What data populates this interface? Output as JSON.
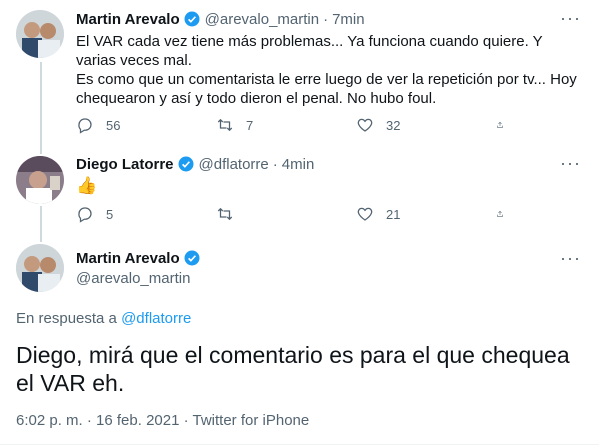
{
  "tweets": [
    {
      "name": "Martin Arevalo",
      "handle": "@arevalo_martin",
      "sep": "·",
      "time": "7min",
      "text": "El VAR cada vez tiene más problemas... Ya funciona cuando quiere. Y varias veces mal.\nEs como que un comentarista le erre luego de ver la repetición por tv... Hoy chequearon y así y todo dieron el penal. No hubo foul.",
      "replies": "56",
      "retweets": "7",
      "likes": "32"
    },
    {
      "name": "Diego Latorre",
      "handle": "@dflatorre",
      "sep": "·",
      "time": "4min",
      "text": "👍",
      "replies": "5",
      "retweets": "",
      "likes": "21"
    }
  ],
  "focus": {
    "name": "Martin Arevalo",
    "handle": "@arevalo_martin",
    "reply_prefix": "En respuesta a",
    "reply_target": "@dflatorre",
    "text": "Diego, mirá que el comentario es para el que chequea el VAR eh.",
    "timestamp": "6:02 p. m. · 16 feb. 2021 · ",
    "source": "Twitter for iPhone"
  },
  "colors": {
    "accent": "#1d9bf0",
    "muted": "#536471",
    "text": "#0f1419"
  },
  "icons": [
    "verified-badge-icon",
    "more-icon",
    "reply-icon",
    "retweet-icon",
    "like-icon",
    "share-icon"
  ]
}
